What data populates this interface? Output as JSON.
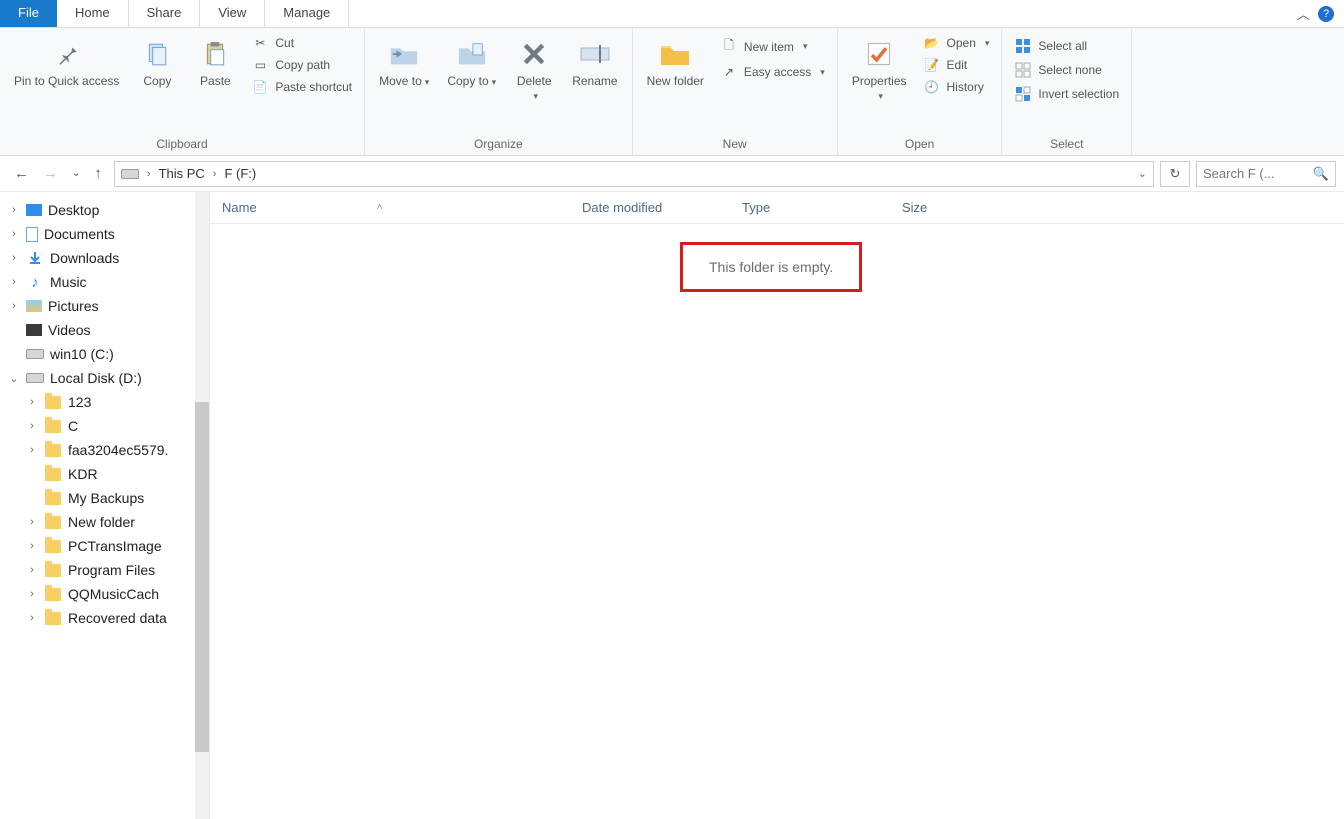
{
  "tabs": {
    "file": "File",
    "home": "Home",
    "share": "Share",
    "view": "View",
    "manage": "Manage"
  },
  "ribbon": {
    "clipboard": {
      "label": "Clipboard",
      "pin": "Pin to Quick access",
      "copy": "Copy",
      "paste": "Paste",
      "cut": "Cut",
      "copypath": "Copy path",
      "pasteshortcut": "Paste shortcut"
    },
    "organize": {
      "label": "Organize",
      "moveto": "Move to",
      "copyto": "Copy to",
      "delete": "Delete",
      "rename": "Rename"
    },
    "new": {
      "label": "New",
      "newfolder": "New folder",
      "newitem": "New item",
      "easyaccess": "Easy access"
    },
    "open": {
      "label": "Open",
      "properties": "Properties",
      "open": "Open",
      "edit": "Edit",
      "history": "History"
    },
    "select": {
      "label": "Select",
      "selectall": "Select all",
      "selectnone": "Select none",
      "invert": "Invert selection"
    }
  },
  "nav": {
    "thisPC": "This PC",
    "current": "F (F:)",
    "searchPlaceholder": "Search F (..."
  },
  "columns": {
    "name": "Name",
    "date": "Date modified",
    "type": "Type",
    "size": "Size"
  },
  "emptyMsg": "This folder is empty.",
  "tree": {
    "desktop": "Desktop",
    "documents": "Documents",
    "downloads": "Downloads",
    "music": "Music",
    "pictures": "Pictures",
    "videos": "Videos",
    "win10": "win10 (C:)",
    "localD": "Local Disk (D:)",
    "d_123": "123",
    "d_C": "C",
    "d_faa": "faa3204ec5579.",
    "d_kdr": "KDR",
    "d_backups": "My Backups",
    "d_newfolder": "New folder",
    "d_pctrans": "PCTransImage",
    "d_program": "Program Files",
    "d_qqmusic": "QQMusicCach",
    "d_recovered": "Recovered data"
  }
}
